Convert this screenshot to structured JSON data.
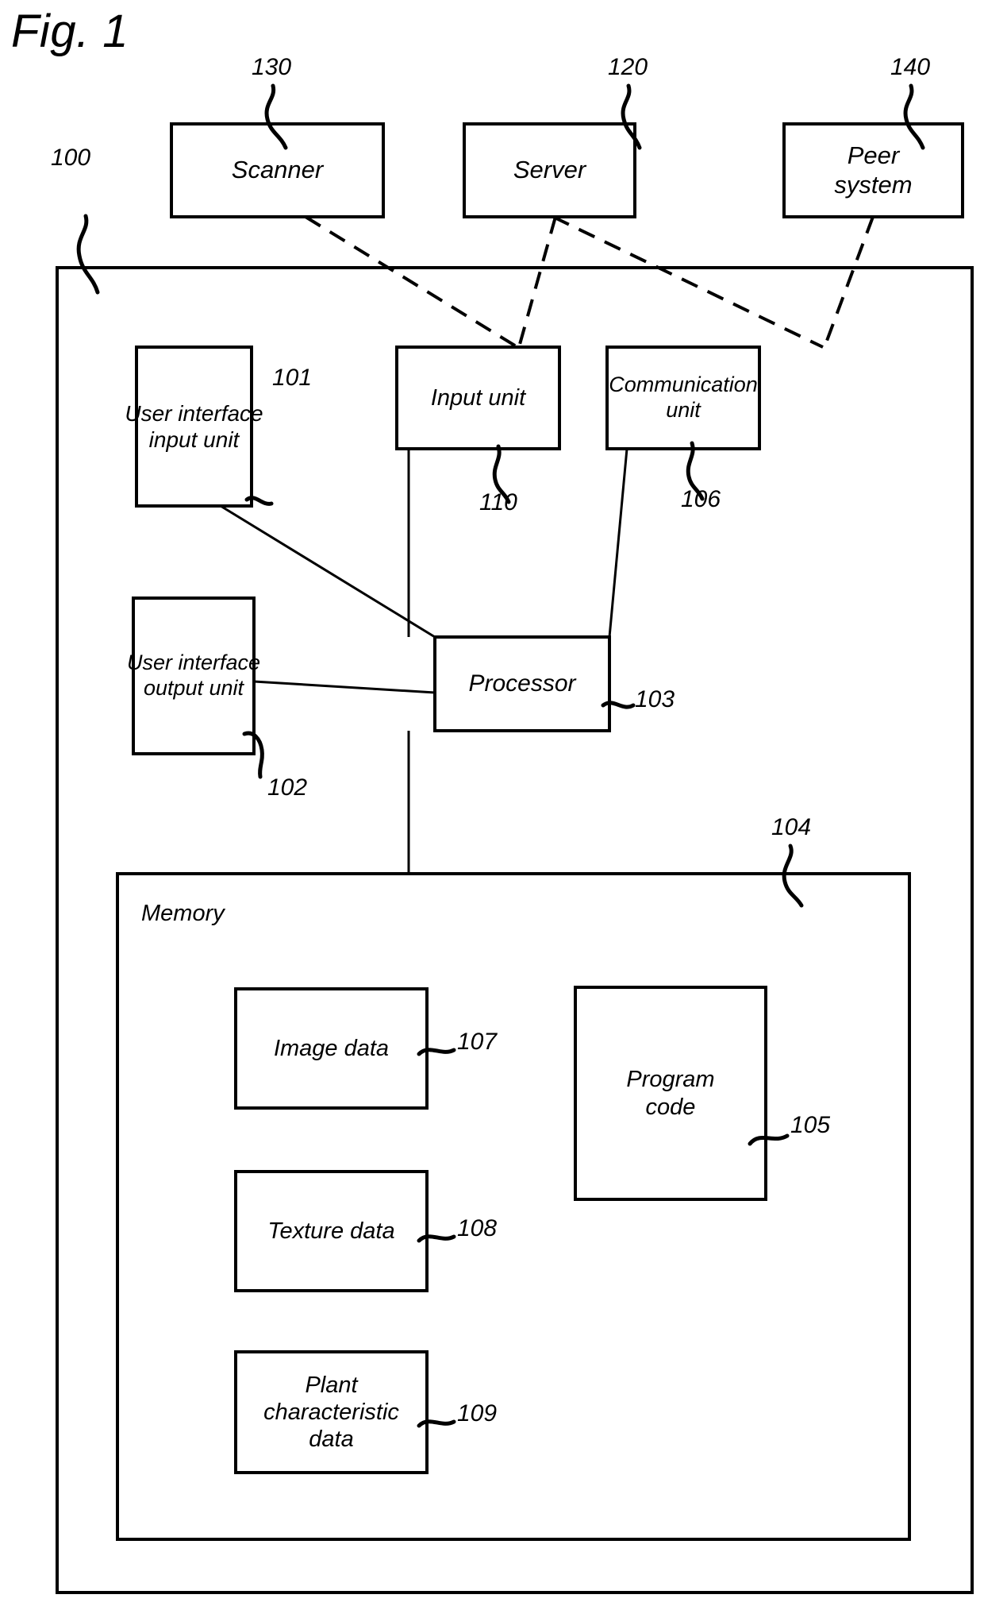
{
  "figure": {
    "title": "Fig. 1",
    "type": "patent-block-diagram"
  },
  "external_nodes": [
    {
      "id": "scanner",
      "label": "Scanner",
      "ref": "130"
    },
    {
      "id": "server",
      "label": "Server",
      "ref": "120"
    },
    {
      "id": "peer_system",
      "label": "Peer\nsystem",
      "ref": "140"
    }
  ],
  "system": {
    "ref": "100",
    "label": ""
  },
  "internal_nodes": [
    {
      "id": "ui_input_unit",
      "label": "User interface\ninput unit",
      "ref": "101"
    },
    {
      "id": "input_unit",
      "label": "Input unit",
      "ref": "110"
    },
    {
      "id": "communication_unit",
      "label": "Communication\nunit",
      "ref": "106"
    },
    {
      "id": "ui_output_unit",
      "label": "User interface\noutput unit",
      "ref": "102"
    },
    {
      "id": "processor",
      "label": "Processor",
      "ref": "103"
    }
  ],
  "memory": {
    "id": "memory",
    "label": "Memory",
    "ref": "104",
    "contents": [
      {
        "id": "image_data",
        "label": "Image data",
        "ref": "107"
      },
      {
        "id": "texture_data",
        "label": "Texture data",
        "ref": "108"
      },
      {
        "id": "plant_characteristic_data",
        "label": "Plant\ncharacteristic\ndata",
        "ref": "109"
      },
      {
        "id": "program_code",
        "label": "Program\ncode",
        "ref": "105"
      }
    ]
  },
  "labels": {
    "scanner": "Scanner",
    "server": "Server",
    "peer_system_line1": "Peer",
    "peer_system_line2": "system",
    "ui_input_line1": "User interface",
    "ui_input_line2": "input unit",
    "input_unit": "Input unit",
    "comm_line1": "Communication",
    "comm_line2": "unit",
    "ui_output_line1": "User interface",
    "ui_output_line2": "output unit",
    "processor": "Processor",
    "memory": "Memory",
    "image_data": "Image data",
    "texture_data": "Texture data",
    "plant_line1": "Plant",
    "plant_line2": "characteristic",
    "plant_line3": "data",
    "program_line1": "Program",
    "program_line2": "code"
  },
  "refs": {
    "r100": "100",
    "r101": "101",
    "r102": "102",
    "r103": "103",
    "r104": "104",
    "r105": "105",
    "r106": "106",
    "r107": "107",
    "r108": "108",
    "r109": "109",
    "r110": "110",
    "r120": "120",
    "r130": "130",
    "r140": "140"
  },
  "colors": {
    "stroke": "#000000",
    "background": "#ffffff"
  }
}
